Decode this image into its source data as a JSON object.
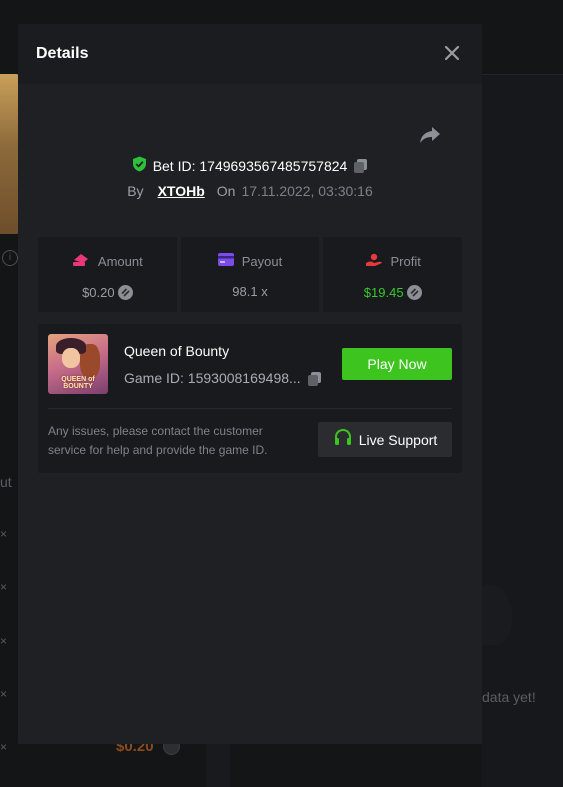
{
  "background": {
    "left_label": "ut",
    "x_marks": [
      "×",
      "×",
      "×",
      "×",
      "×"
    ],
    "no_data_text": "data yet!",
    "amount_text": "$0.20",
    "info_icon": "i"
  },
  "modal": {
    "title": "Details",
    "bet_id_label": "Bet ID: 1749693567485757824",
    "by_label": "By",
    "user": "XTOHb",
    "on_label": "On",
    "date": "17.11.2022, 03:30:16",
    "icons": {
      "close": "close-icon",
      "share": "share-icon",
      "verified": "shield-check-icon",
      "copy": "copy-icon"
    }
  },
  "stats": [
    {
      "label": "Amount",
      "value": "$0.20",
      "icon": "amount-icon",
      "color": "#e8387b"
    },
    {
      "label": "Payout",
      "value": "98.1 x",
      "icon": "card-icon",
      "color": "#7b4de8"
    },
    {
      "label": "Profit",
      "value": "$19.45",
      "icon": "profit-icon",
      "color": "#e83a3a"
    }
  ],
  "game": {
    "thumb_text": "QUEEN of BOUNTY",
    "name": "Queen of Bounty",
    "id": "Game ID: 1593008169498...",
    "play_label": "Play Now",
    "help_text": "Any issues, please contact the customer service for help and provide the game ID.",
    "support_label": "Live Support"
  },
  "colors": {
    "accent_green": "#3ec41f",
    "profit_green": "#36c92b"
  }
}
